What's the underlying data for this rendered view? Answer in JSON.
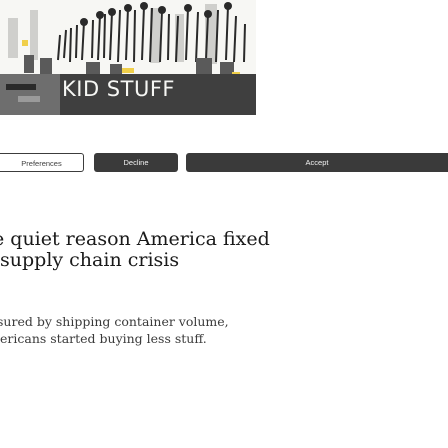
{
  "hero": {
    "label": "KID STUFF",
    "icon": "crowd-illustration-icon",
    "colors": {
      "background": "#f7f7f4",
      "ink": "#2a2a2a",
      "mid": "#7a7a7a",
      "accent": "#f0cf4a"
    }
  },
  "consent": {
    "preferences_label": "Preferences",
    "decline_label": "Decline",
    "accept_label": "Accept",
    "colors": {
      "dark": "#3a3a3a",
      "light_text": "#f2f2f2"
    }
  },
  "article": {
    "headline": "e quiet reason America fixed\nsupply chain crisis",
    "dek": "sured by shipping container volume,\nericans started buying less stuff."
  }
}
